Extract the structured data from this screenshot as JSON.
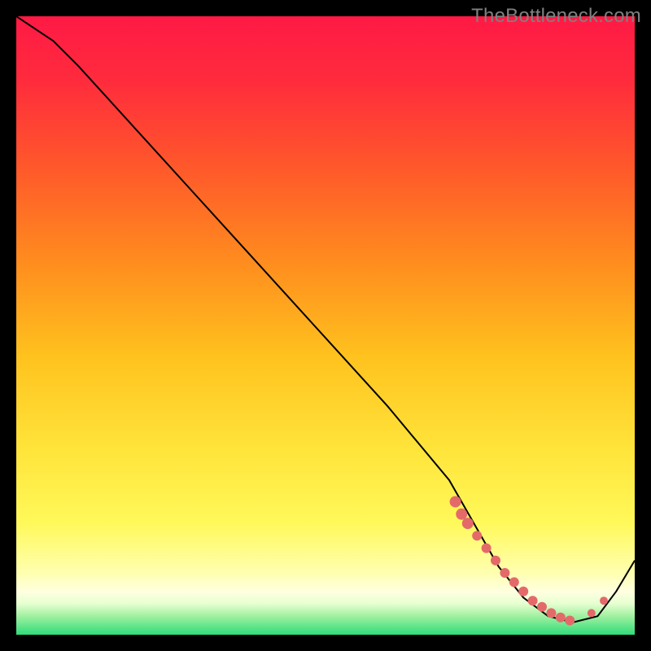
{
  "watermark": "TheBottleneck.com",
  "colors": {
    "frame": "#000000",
    "watermark_text": "#808080",
    "curve": "#000000",
    "marker": "#e46a6a",
    "gradient_stops": [
      {
        "offset": 0.0,
        "color": "#ff1a45"
      },
      {
        "offset": 0.1,
        "color": "#ff2a3d"
      },
      {
        "offset": 0.25,
        "color": "#ff5a2a"
      },
      {
        "offset": 0.4,
        "color": "#ff8d1e"
      },
      {
        "offset": 0.55,
        "color": "#ffc21e"
      },
      {
        "offset": 0.7,
        "color": "#ffe43a"
      },
      {
        "offset": 0.82,
        "color": "#fff95a"
      },
      {
        "offset": 0.9,
        "color": "#ffffb0"
      },
      {
        "offset": 0.93,
        "color": "#ffffe0"
      },
      {
        "offset": 0.95,
        "color": "#e6ffd0"
      },
      {
        "offset": 0.97,
        "color": "#a0f0a0"
      },
      {
        "offset": 1.0,
        "color": "#2fdc7a"
      }
    ]
  },
  "chart_data": {
    "type": "line",
    "title": "",
    "xlabel": "",
    "ylabel": "",
    "xlim": [
      0,
      100
    ],
    "ylim": [
      0,
      100
    ],
    "series": [
      {
        "name": "bottleneck-curve",
        "x": [
          0,
          6,
          10,
          20,
          30,
          40,
          50,
          60,
          70,
          74,
          78,
          82,
          86,
          90,
          94,
          97,
          100
        ],
        "y": [
          100,
          96,
          92,
          81,
          70,
          59,
          48,
          37,
          25,
          18,
          11,
          6,
          3,
          2,
          3,
          7,
          12
        ]
      }
    ],
    "markers": {
      "name": "highlight-points",
      "x": [
        71,
        72,
        73,
        74.5,
        76,
        77.5,
        79,
        80.5,
        82,
        83.5,
        85,
        86.5,
        88,
        89.5,
        93,
        95
      ],
      "y": [
        21.5,
        19.5,
        18,
        16,
        14,
        12,
        10,
        8.5,
        7,
        5.5,
        4.5,
        3.5,
        2.8,
        2.3,
        3.5,
        5.5
      ],
      "r": [
        7,
        7,
        7,
        6,
        6,
        6,
        6,
        6,
        6,
        6,
        6,
        6,
        6,
        6,
        5,
        5
      ]
    }
  }
}
